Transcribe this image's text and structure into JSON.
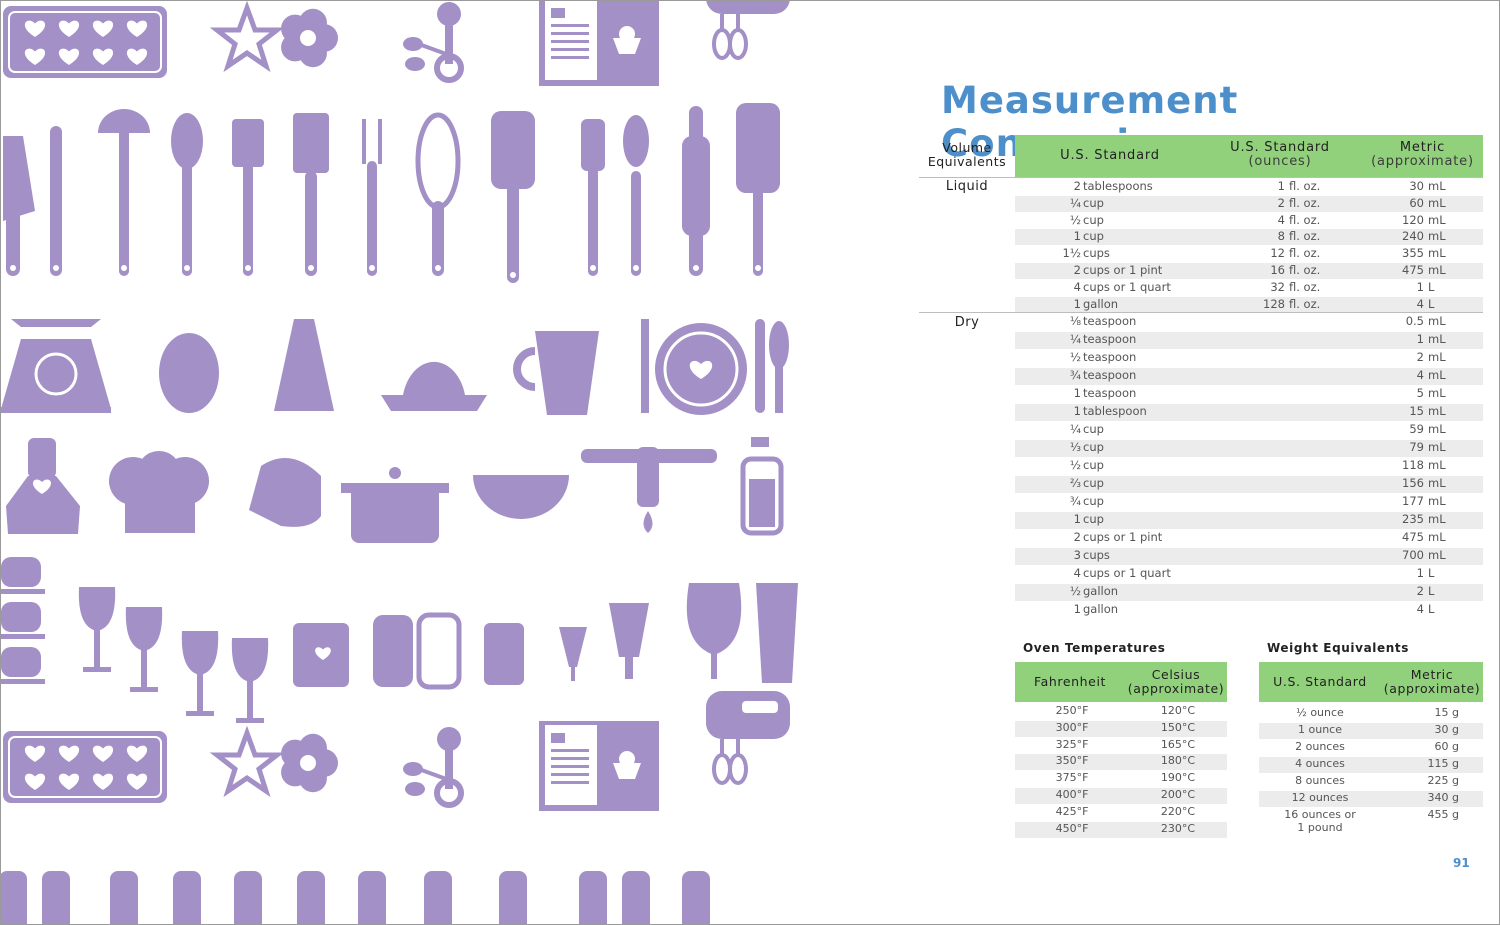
{
  "page": {
    "title": "Measurement Conversions",
    "page_number": "91",
    "accent_color": "#4d8fca",
    "header_green": "#92d17c",
    "illustration_color": "#a290c6",
    "illustration_icons": [
      "silicone-mold-icon",
      "star-cookie-cutter-icon",
      "flower-cookie-cutter-icon",
      "measuring-spoons-icon",
      "recipe-book-icon",
      "hand-mixer-icon",
      "knife-icon",
      "butter-knife-icon",
      "ladle-icon",
      "slotted-spoon-icon",
      "spatula-icon",
      "fork-icon",
      "whisk-icon",
      "rubber-spatula-icon",
      "wooden-spoon-icon",
      "rolling-pin-icon",
      "kitchen-scale-icon",
      "egg-timer-icon",
      "grater-icon",
      "juicer-icon",
      "measuring-cup-icon",
      "plate-setting-icon",
      "apron-icon",
      "chef-hat-icon",
      "oven-mitt-icon",
      "pot-icon",
      "colander-icon",
      "faucet-icon",
      "soap-dispenser-icon",
      "teacups-icon",
      "wine-glass-icon",
      "mug-icon",
      "salt-pepper-shakers-icon",
      "beer-glass-icon"
    ]
  },
  "volume": {
    "header_label": [
      "Volume",
      "Equivalents"
    ],
    "col1": "U.S. Standard",
    "col2": [
      "U.S. Standard",
      "(ounces)"
    ],
    "col3": [
      "Metric",
      "(approximate)"
    ],
    "liquid_label": "Liquid",
    "dry_label": "Dry",
    "liquid": [
      {
        "amt": "2",
        "unit": "tablespoons",
        "oz": "1",
        "ozu": "fl. oz.",
        "ml": "30",
        "mlu": "mL"
      },
      {
        "amt": "¼",
        "unit": "cup",
        "oz": "2",
        "ozu": "fl. oz.",
        "ml": "60",
        "mlu": "mL"
      },
      {
        "amt": "½",
        "unit": "cup",
        "oz": "4",
        "ozu": "fl. oz.",
        "ml": "120",
        "mlu": "mL"
      },
      {
        "amt": "1",
        "unit": "cup",
        "oz": "8",
        "ozu": "fl. oz.",
        "ml": "240",
        "mlu": "mL"
      },
      {
        "amt": "1½",
        "unit": "cups",
        "oz": "12",
        "ozu": "fl. oz.",
        "ml": "355",
        "mlu": "mL"
      },
      {
        "amt": "2",
        "unit": "cups or 1 pint",
        "oz": "16",
        "ozu": "fl. oz.",
        "ml": "475",
        "mlu": "mL"
      },
      {
        "amt": "4",
        "unit": "cups or 1 quart",
        "oz": "32",
        "ozu": "fl. oz.",
        "ml": "1",
        "mlu": "L"
      },
      {
        "amt": "1",
        "unit": "gallon",
        "oz": "128",
        "ozu": "fl. oz.",
        "ml": "4",
        "mlu": "L"
      }
    ],
    "dry": [
      {
        "amt": "⅛",
        "unit": "teaspoon",
        "ml": "0.5",
        "mlu": "mL"
      },
      {
        "amt": "¼",
        "unit": "teaspoon",
        "ml": "1",
        "mlu": "mL"
      },
      {
        "amt": "½",
        "unit": "teaspoon",
        "ml": "2",
        "mlu": "mL"
      },
      {
        "amt": "¾",
        "unit": "teaspoon",
        "ml": "4",
        "mlu": "mL"
      },
      {
        "amt": "1",
        "unit": "teaspoon",
        "ml": "5",
        "mlu": "mL"
      },
      {
        "amt": "1",
        "unit": "tablespoon",
        "ml": "15",
        "mlu": "mL"
      },
      {
        "amt": "¼",
        "unit": "cup",
        "ml": "59",
        "mlu": "mL"
      },
      {
        "amt": "⅓",
        "unit": "cup",
        "ml": "79",
        "mlu": "mL"
      },
      {
        "amt": "½",
        "unit": "cup",
        "ml": "118",
        "mlu": "mL"
      },
      {
        "amt": "⅔",
        "unit": "cup",
        "ml": "156",
        "mlu": "mL"
      },
      {
        "amt": "¾",
        "unit": "cup",
        "ml": "177",
        "mlu": "mL"
      },
      {
        "amt": "1",
        "unit": "cup",
        "ml": "235",
        "mlu": "mL"
      },
      {
        "amt": "2",
        "unit": "cups or 1 pint",
        "ml": "475",
        "mlu": "mL"
      },
      {
        "amt": "3",
        "unit": "cups",
        "ml": "700",
        "mlu": "mL"
      },
      {
        "amt": "4",
        "unit": "cups or 1 quart",
        "ml": "1",
        "mlu": "L"
      },
      {
        "amt": "½",
        "unit": "gallon",
        "ml": "2",
        "mlu": "L"
      },
      {
        "amt": "1",
        "unit": "gallon",
        "ml": "4",
        "mlu": "L"
      }
    ]
  },
  "oven": {
    "title": "Oven Temperatures",
    "col1": "Fahrenheit",
    "col2": [
      "Celsius",
      "(approximate)"
    ],
    "rows": [
      {
        "f": "250°F",
        "c": "120°C"
      },
      {
        "f": "300°F",
        "c": "150°C"
      },
      {
        "f": "325°F",
        "c": "165°C"
      },
      {
        "f": "350°F",
        "c": "180°C"
      },
      {
        "f": "375°F",
        "c": "190°C"
      },
      {
        "f": "400°F",
        "c": "200°C"
      },
      {
        "f": "425°F",
        "c": "220°C"
      },
      {
        "f": "450°F",
        "c": "230°C"
      }
    ]
  },
  "weight": {
    "title": "Weight Equivalents",
    "col1": "U.S. Standard",
    "col2": [
      "Metric",
      "(approximate)"
    ],
    "rows": [
      {
        "us": "½ ounce",
        "m": "15 g"
      },
      {
        "us": "1 ounce",
        "m": "30 g"
      },
      {
        "us": "2 ounces",
        "m": "60 g"
      },
      {
        "us": "4 ounces",
        "m": "115 g"
      },
      {
        "us": "8 ounces",
        "m": "225 g"
      },
      {
        "us": "12 ounces",
        "m": "340 g"
      },
      {
        "us": "16 ounces or",
        "us2": "1 pound",
        "m": "455 g"
      }
    ]
  }
}
